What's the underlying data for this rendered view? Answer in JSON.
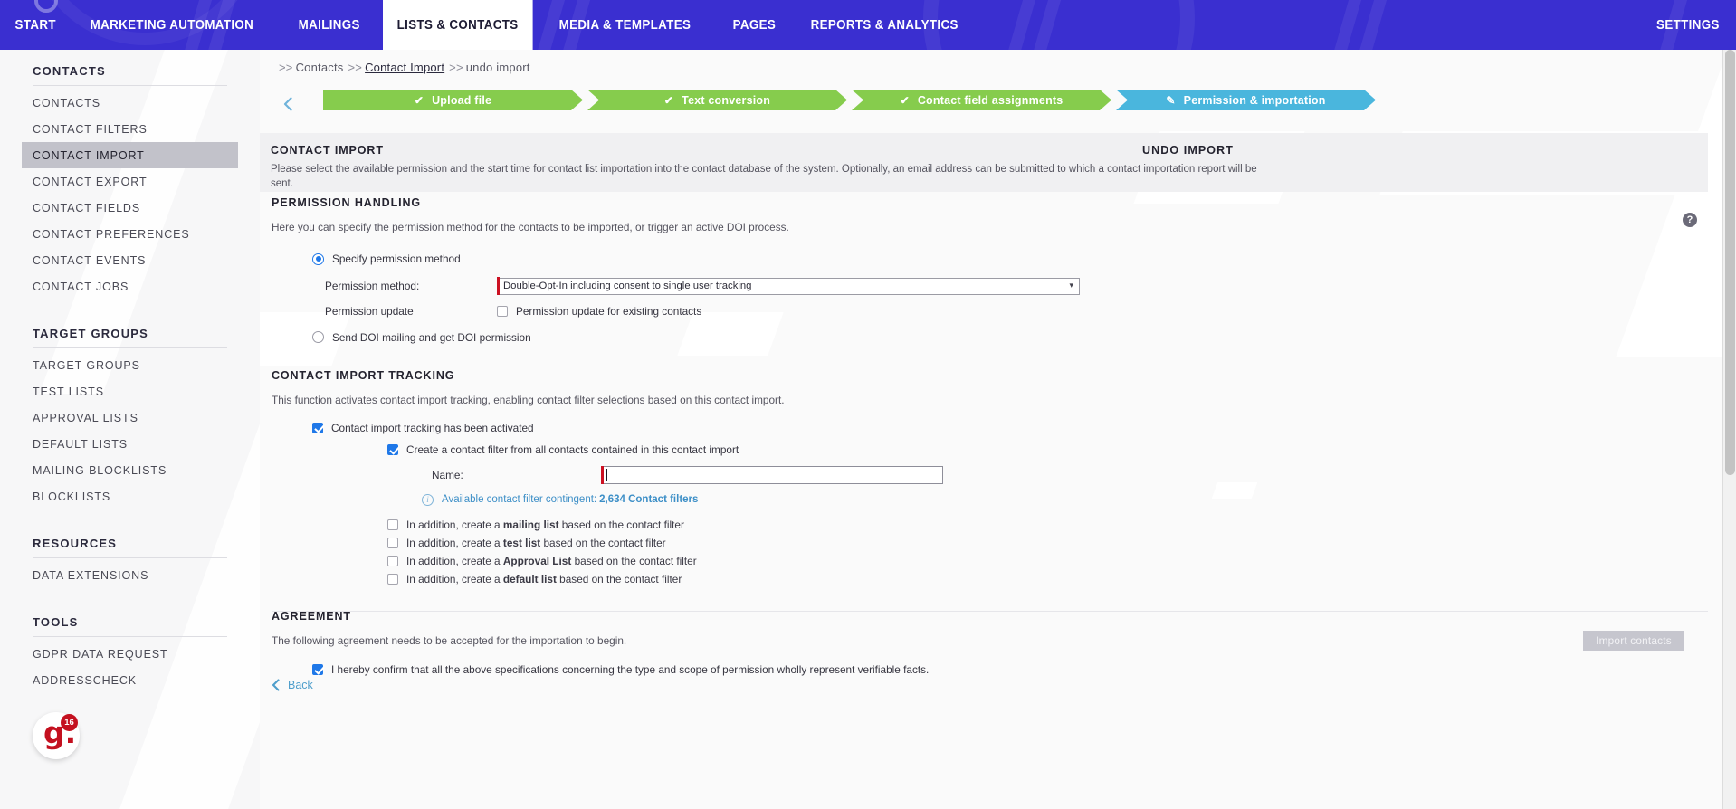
{
  "topnav": {
    "items": [
      {
        "label": "START",
        "active": false
      },
      {
        "label": "MARKETING AUTOMATION",
        "active": false
      },
      {
        "label": "MAILINGS",
        "active": false
      },
      {
        "label": "LISTS & CONTACTS",
        "active": true
      },
      {
        "label": "MEDIA & TEMPLATES",
        "active": false
      },
      {
        "label": "PAGES",
        "active": false
      },
      {
        "label": "REPORTS & ANALYTICS",
        "active": false
      }
    ],
    "settings_label": "SETTINGS",
    "background_color": "#3a2fd0"
  },
  "sidebar": {
    "groups": [
      {
        "title": "CONTACTS",
        "items": [
          {
            "label": "CONTACTS",
            "active": false
          },
          {
            "label": "CONTACT FILTERS",
            "active": false
          },
          {
            "label": "CONTACT IMPORT",
            "active": true
          },
          {
            "label": "CONTACT EXPORT",
            "active": false
          },
          {
            "label": "CONTACT FIELDS",
            "active": false
          },
          {
            "label": "CONTACT PREFERENCES",
            "active": false
          },
          {
            "label": "CONTACT EVENTS",
            "active": false
          },
          {
            "label": "CONTACT JOBS",
            "active": false
          }
        ]
      },
      {
        "title": "TARGET GROUPS",
        "items": [
          {
            "label": "TARGET GROUPS",
            "active": false
          },
          {
            "label": "TEST LISTS",
            "active": false
          },
          {
            "label": "APPROVAL LISTS",
            "active": false
          },
          {
            "label": "DEFAULT LISTS",
            "active": false
          },
          {
            "label": "MAILING BLOCKLISTS",
            "active": false
          },
          {
            "label": "BLOCKLISTS",
            "active": false
          }
        ]
      },
      {
        "title": "RESOURCES",
        "items": [
          {
            "label": "DATA EXTENSIONS",
            "active": false
          }
        ]
      },
      {
        "title": "TOOLS",
        "items": [
          {
            "label": "GDPR DATA REQUEST",
            "active": false
          },
          {
            "label": "ADDRESSCHECK",
            "active": false
          }
        ]
      }
    ],
    "logo": {
      "letter": "g.",
      "badge": "16",
      "color": "#c4101f"
    }
  },
  "breadcrumb": {
    "sep": ">>",
    "items": [
      "Contacts",
      "Contact Import",
      "undo import"
    ]
  },
  "steps": [
    {
      "label": "Upload file",
      "state": "done",
      "icon": "check-icon"
    },
    {
      "label": "Text conversion",
      "state": "done",
      "icon": "check-icon"
    },
    {
      "label": "Contact field assignments",
      "state": "done",
      "icon": "check-icon"
    },
    {
      "label": "Permission & importation",
      "state": "current",
      "icon": "pencil-icon"
    }
  ],
  "header_panel": {
    "title": "CONTACT IMPORT",
    "description": "Please select the available permission and the start time for contact list importation into the contact database of the system. Optionally, an email address can be submitted to which a contact importation report will be sent.",
    "right_title": "UNDO IMPORT"
  },
  "permission_handling": {
    "title": "PERMISSION HANDLING",
    "description": "Here you can specify the permission method for the contacts to be imported, or trigger an active DOI process.",
    "radio_specify": {
      "label": "Specify permission method",
      "checked": true
    },
    "method_label": "Permission method:",
    "method_value": "Double-Opt-In including consent to single user tracking",
    "method_options": [
      "Double-Opt-In including consent to single user tracking"
    ],
    "update_label": "Permission update",
    "update_checkbox": {
      "label": "Permission update for existing contacts",
      "checked": false
    },
    "radio_doi": {
      "label": "Send DOI mailing and  get DOI permission",
      "checked": false
    }
  },
  "tracking": {
    "title": "CONTACT IMPORT TRACKING",
    "description": "This function activates contact import tracking, enabling contact filter selections based on this contact import.",
    "activated": {
      "label": "Contact import tracking has been activated",
      "checked": true
    },
    "create_filter": {
      "label": "Create a contact filter from all contacts contained in this contact import",
      "checked": true
    },
    "name_label": "Name:",
    "name_value": "",
    "name_placeholder": "",
    "contingent": {
      "text": "Available contact filter contingent:",
      "value": "2,634 Contact filters",
      "icon": "info-icon"
    },
    "extra_options": [
      {
        "prefix": "In addition, create a ",
        "bold": "mailing list",
        "suffix": " based on the contact filter",
        "checked": false
      },
      {
        "prefix": "In addition, create a ",
        "bold": "test list",
        "suffix": " based on the contact filter",
        "checked": false
      },
      {
        "prefix": "In addition, create a ",
        "bold": "Approval List",
        "suffix": " based on the contact filter",
        "checked": false
      },
      {
        "prefix": "In addition, create a ",
        "bold": "default list",
        "suffix": " based on the contact filter",
        "checked": false
      }
    ]
  },
  "agreement": {
    "title": "AGREEMENT",
    "description": "The following agreement needs to be accepted for the importation to begin.",
    "confirm": {
      "label": "I hereby confirm that all the above specifications concerning the type and scope of permission wholly represent verifiable facts.",
      "checked": true
    }
  },
  "footer": {
    "import_button": "Import contacts",
    "import_button_disabled": true,
    "back_label": "Back",
    "help_label": "?"
  }
}
